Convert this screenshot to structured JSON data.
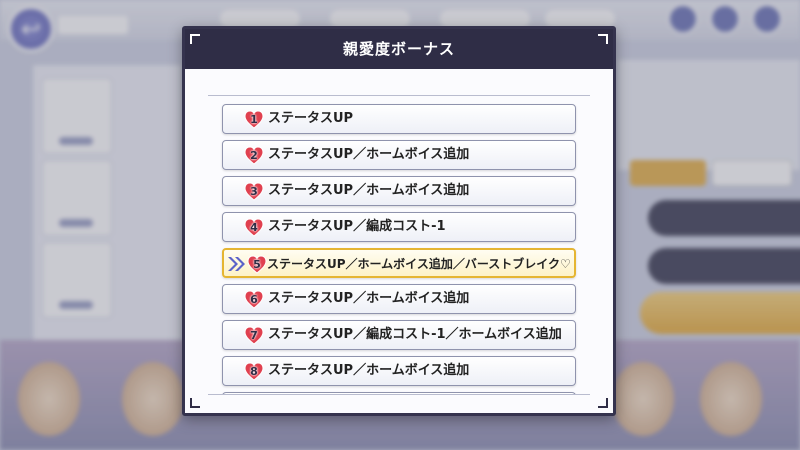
{
  "dialog": {
    "title": "親愛度ボーナス"
  },
  "bonuses": [
    {
      "level": "1",
      "label": "ステータスUP",
      "active": false
    },
    {
      "level": "2",
      "label": "ステータスUP／ホームボイス追加",
      "active": false
    },
    {
      "level": "3",
      "label": "ステータスUP／ホームボイス追加",
      "active": false
    },
    {
      "level": "4",
      "label": "ステータスUP／編成コスト-1",
      "active": false
    },
    {
      "level": "5",
      "label": "ステータスUP／ホームボイス追加／バーストブレイク♡",
      "active": true
    },
    {
      "level": "6",
      "label": "ステータスUP／ホームボイス追加",
      "active": false
    },
    {
      "level": "7",
      "label": "ステータスUP／編成コスト-1／ホームボイス追加",
      "active": false
    },
    {
      "level": "8",
      "label": "ステータスUP／ホームボイス追加",
      "active": false
    }
  ],
  "colors": {
    "header_bg": "#2f2d46",
    "heart": "#e0404f",
    "active_border": "#e5b532",
    "current_arrow": "#5b62c9"
  },
  "icons": {
    "heart": "heart-icon",
    "current": "double-chevron-right-icon"
  }
}
